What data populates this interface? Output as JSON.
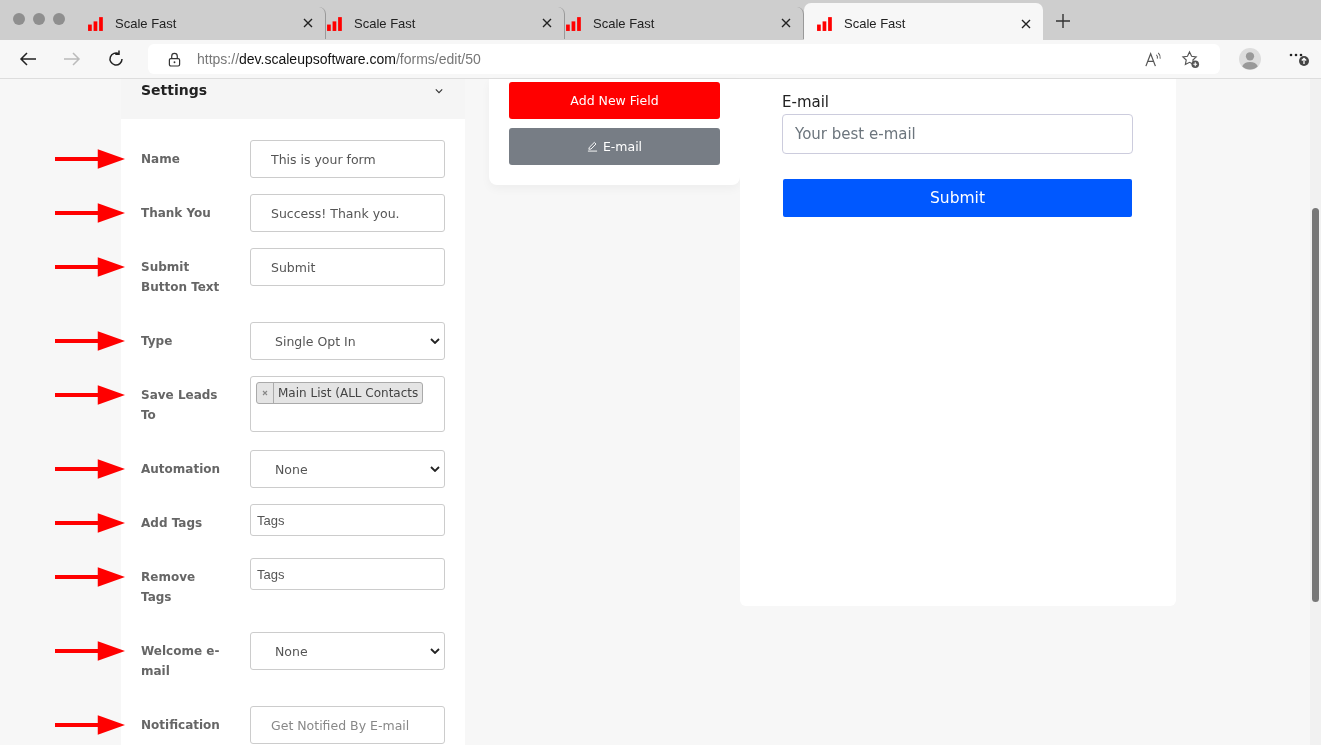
{
  "browser": {
    "tabs": [
      {
        "title": "Scale Fast",
        "selected": false
      },
      {
        "title": "Scale Fast",
        "selected": false
      },
      {
        "title": "Scale Fast",
        "selected": false
      },
      {
        "title": "Scale Fast",
        "selected": true
      }
    ],
    "url": {
      "scheme": "https://",
      "host": "dev.scaleupsoftware.com",
      "path": "/forms/edit/50"
    }
  },
  "settings": {
    "title": "Settings",
    "fields": [
      {
        "label": "Name",
        "kind": "text",
        "value": "This is your form"
      },
      {
        "label": "Thank You",
        "kind": "text",
        "value": "Success! Thank you."
      },
      {
        "label": "Submit Button Text",
        "kind": "text",
        "value": "Submit"
      },
      {
        "label": "Type",
        "kind": "select",
        "value": "Single Opt In"
      },
      {
        "label": "Save Leads To",
        "kind": "tags",
        "tags": [
          "Main List (ALL Contacts"
        ]
      },
      {
        "label": "Automation",
        "kind": "select",
        "value": "None"
      },
      {
        "label": "Add Tags",
        "kind": "tagsinput",
        "placeholder": "Tags"
      },
      {
        "label": "Remove Tags",
        "kind": "tagsinput",
        "placeholder": "Tags"
      },
      {
        "label": "Welcome e-mail",
        "kind": "select",
        "value": "None"
      },
      {
        "label": "Notification",
        "kind": "text",
        "placeholder": "Get Notified By E-mail"
      }
    ]
  },
  "fields_panel": {
    "buttons": [
      {
        "label": "Add New Field",
        "kind": "add"
      },
      {
        "label": "E-mail",
        "kind": "field"
      }
    ]
  },
  "preview": {
    "field_label": "E-mail",
    "placeholder": "Your best e-mail",
    "submit": "Submit"
  }
}
